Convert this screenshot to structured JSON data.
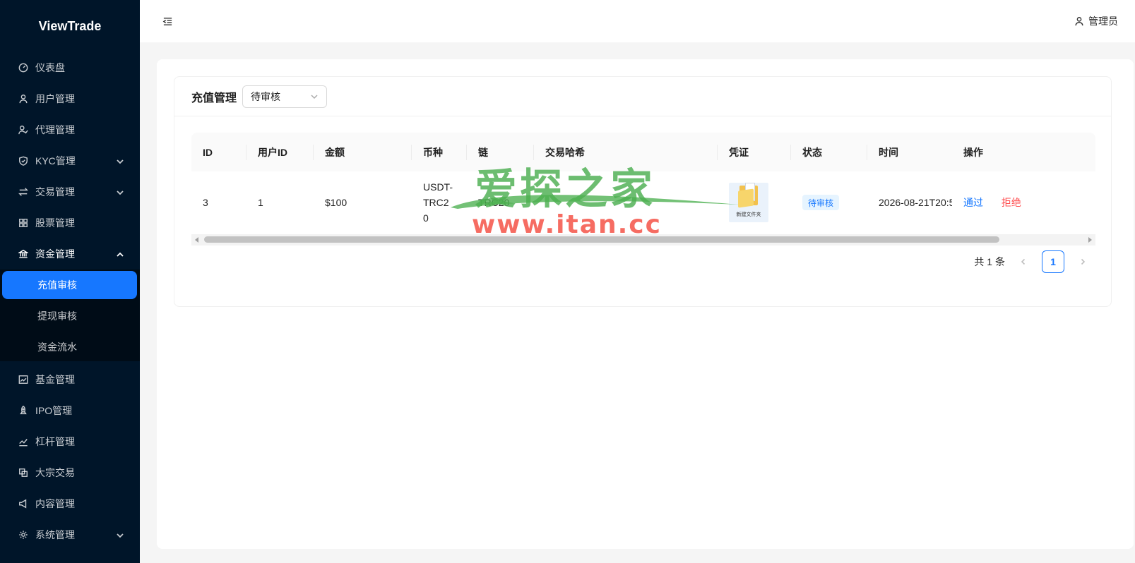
{
  "brand": "ViewTrade",
  "sidebar": {
    "items_top": [
      {
        "label": "仪表盘",
        "icon": "dashboard-icon"
      },
      {
        "label": "用户管理",
        "icon": "user-icon"
      },
      {
        "label": "代理管理",
        "icon": "agent-icon"
      },
      {
        "label": "KYC管理",
        "icon": "shield-icon"
      },
      {
        "label": "交易管理",
        "icon": "swap-icon"
      },
      {
        "label": "股票管理",
        "icon": "grid-icon"
      },
      {
        "label": "资金管理",
        "icon": "bank-icon"
      }
    ],
    "sub_items": [
      {
        "label": "充值审核"
      },
      {
        "label": "提现审核"
      },
      {
        "label": "资金流水"
      }
    ],
    "items_bottom": [
      {
        "label": "基金管理",
        "icon": "fund-chart-icon"
      },
      {
        "label": "IPO管理",
        "icon": "rocket-icon"
      },
      {
        "label": "杠杆管理",
        "icon": "stock-chart-icon"
      },
      {
        "label": "大宗交易",
        "icon": "block-icon"
      },
      {
        "label": "内容管理",
        "icon": "notification-icon"
      },
      {
        "label": "系统管理",
        "icon": "setting-icon"
      }
    ]
  },
  "header": {
    "user_label": "管理员"
  },
  "page": {
    "title": "充值管理",
    "status_filter": "待审核"
  },
  "table": {
    "columns": [
      "ID",
      "用户ID",
      "金额",
      "币种",
      "链",
      "交易哈希",
      "凭证",
      "状态",
      "时间",
      "操作"
    ],
    "rows": [
      {
        "id": "3",
        "user_id": "1",
        "amount": "$100",
        "currency": "USDT-TRC20",
        "chain": "TRC20",
        "tx_hash": "",
        "voucher_caption": "新建文件夹",
        "status": "待审核",
        "time": "2026-08-21T20:5",
        "approve": "通过",
        "reject": "拒绝"
      }
    ]
  },
  "pagination": {
    "total_text": "共 1 条",
    "current": "1"
  },
  "watermark": {
    "cn": "爱探之家",
    "url": "www.itan.cc"
  },
  "colors": {
    "primary": "#1677ff",
    "danger": "#ff4d4f",
    "sidebar_bg": "#001529"
  }
}
